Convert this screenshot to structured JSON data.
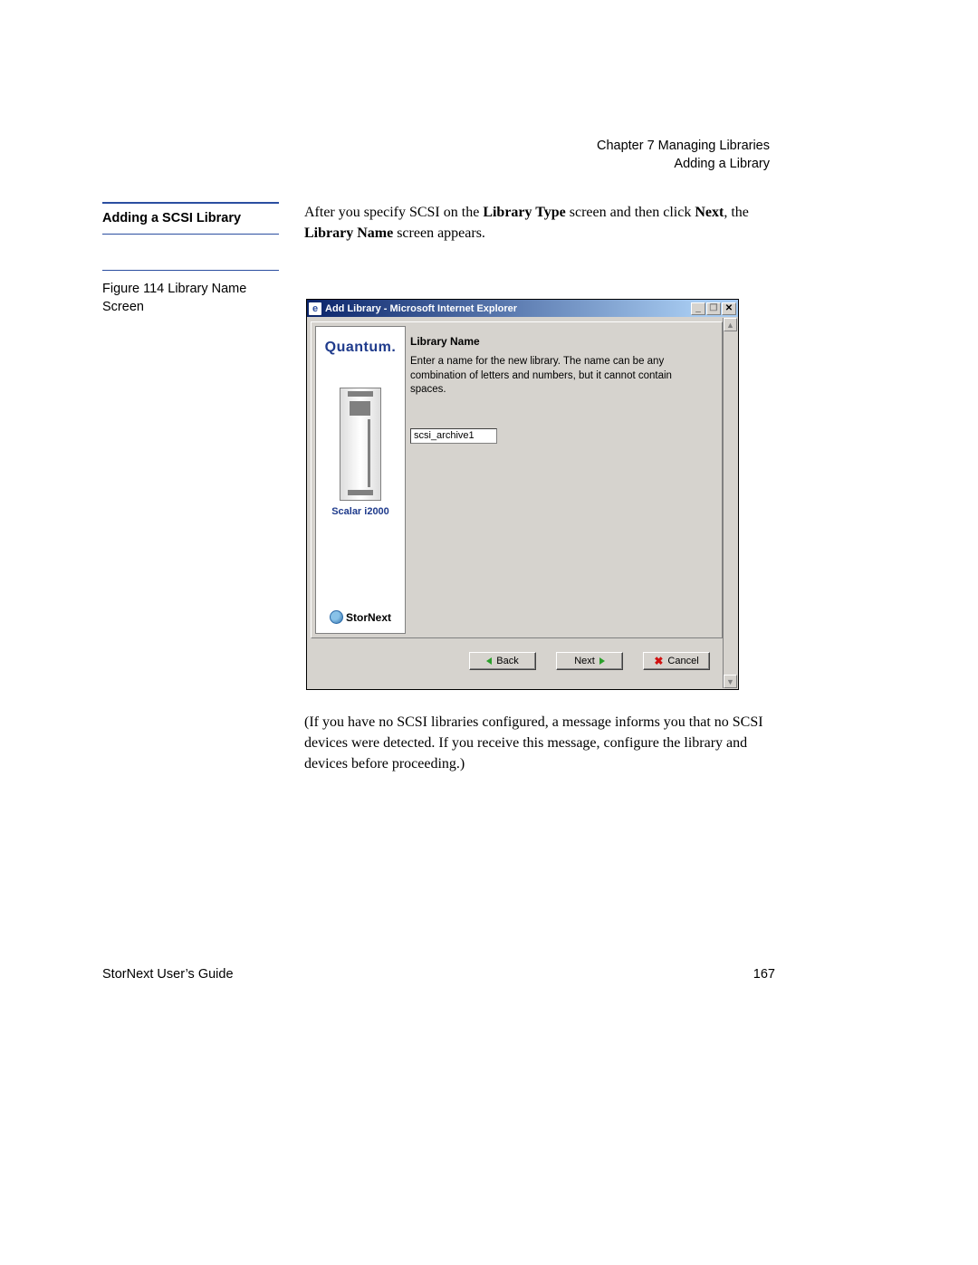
{
  "header": {
    "chapter": "Chapter 7  Managing Libraries",
    "section": "Adding a Library"
  },
  "section_heading": "Adding a SCSI Library",
  "intro": {
    "pre": "After you specify SCSI on the ",
    "b1": "Library Type",
    "mid1": " screen and then click ",
    "b2": "Next",
    "mid2": ", the ",
    "b3": "Library Name",
    "post": " screen appears."
  },
  "figure_caption": "Figure 114  Library Name Screen",
  "window": {
    "title": "Add Library - Microsoft Internet Explorer",
    "min_glyph": "_",
    "restore_glyph": "❐",
    "close_glyph": "✕",
    "scroll_up": "▲",
    "scroll_down": "▼"
  },
  "sidebar": {
    "brand": "Quantum.",
    "product": "Scalar i2000",
    "stornext": "StorNext"
  },
  "panel": {
    "heading": "Library Name",
    "desc": "Enter a name for the new library. The name can be any combination of letters and numbers, but it cannot contain spaces.",
    "input_value": "scsi_archive1"
  },
  "buttons": {
    "back": "Back",
    "next": "Next",
    "cancel": "Cancel"
  },
  "after_para": "(If you have no SCSI libraries configured, a message informs you that no SCSI devices were detected. If you receive this message, configure the library and devices before proceeding.)",
  "footer": {
    "left": "StorNext User’s Guide",
    "page": "167"
  }
}
